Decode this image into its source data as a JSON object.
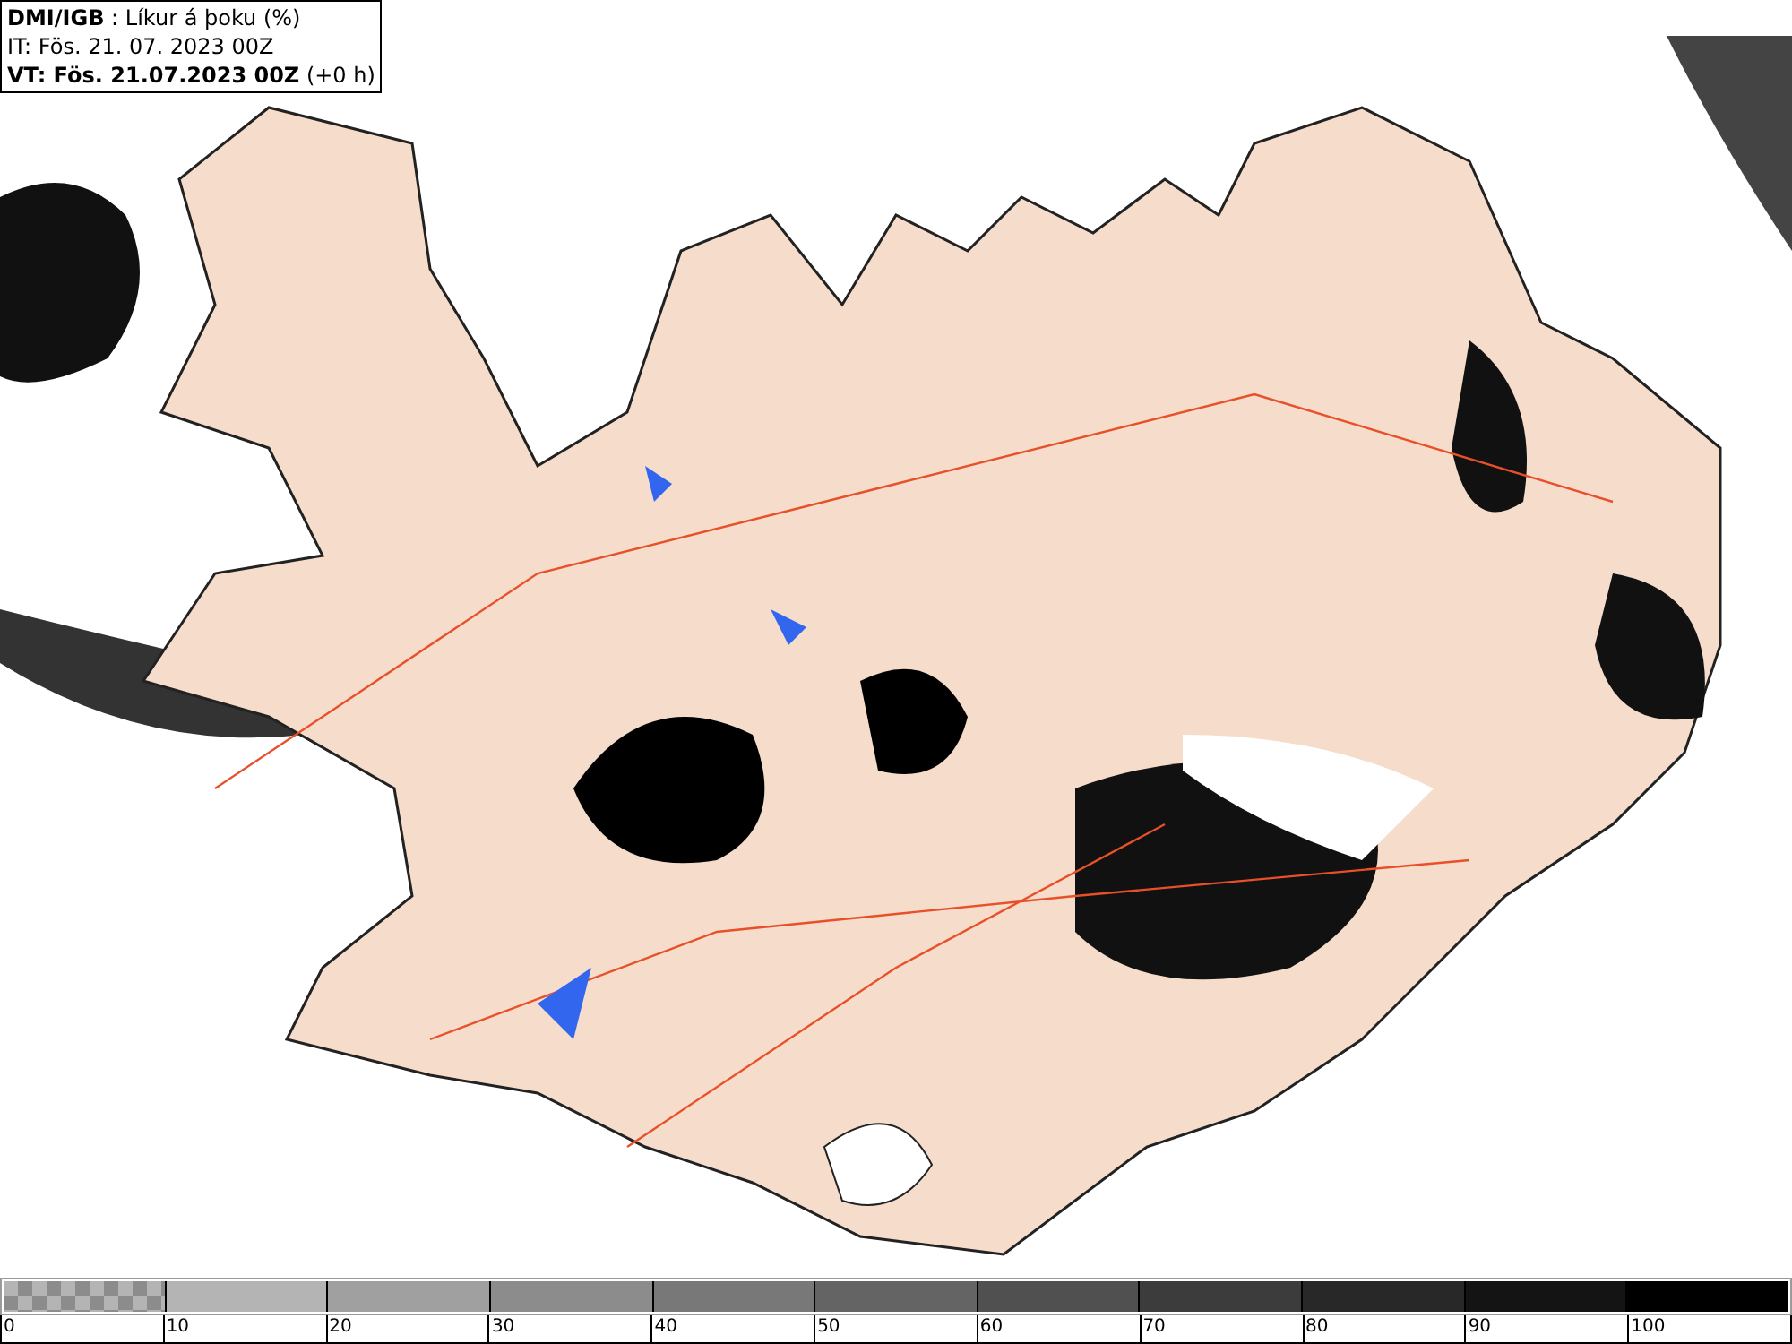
{
  "header": {
    "lines": [
      "**DMI/IGB** : Líkur á þoku (%)",
      "IT: Fös. 21. 07. 2023 00Z",
      "**VT: Fös. 21.07.2023 00Z** (+0 h)"
    ]
  },
  "legend": {
    "segments": [
      {
        "kind": "checkered",
        "color": "#8c8c8c",
        "label": "0"
      },
      {
        "kind": "solid",
        "color": "#b4b4b4",
        "label": "10"
      },
      {
        "kind": "solid",
        "color": "#a0a0a0",
        "label": "20"
      },
      {
        "kind": "solid",
        "color": "#8c8c8c",
        "label": "30"
      },
      {
        "kind": "solid",
        "color": "#787878",
        "label": "40"
      },
      {
        "kind": "solid",
        "color": "#646464",
        "label": "50"
      },
      {
        "kind": "solid",
        "color": "#505050",
        "label": "60"
      },
      {
        "kind": "solid",
        "color": "#3c3c3c",
        "label": "70"
      },
      {
        "kind": "solid",
        "color": "#282828",
        "label": "80"
      },
      {
        "kind": "solid",
        "color": "#141414",
        "label": "90"
      },
      {
        "kind": "solid",
        "color": "#000000",
        "label": "100"
      }
    ]
  }
}
